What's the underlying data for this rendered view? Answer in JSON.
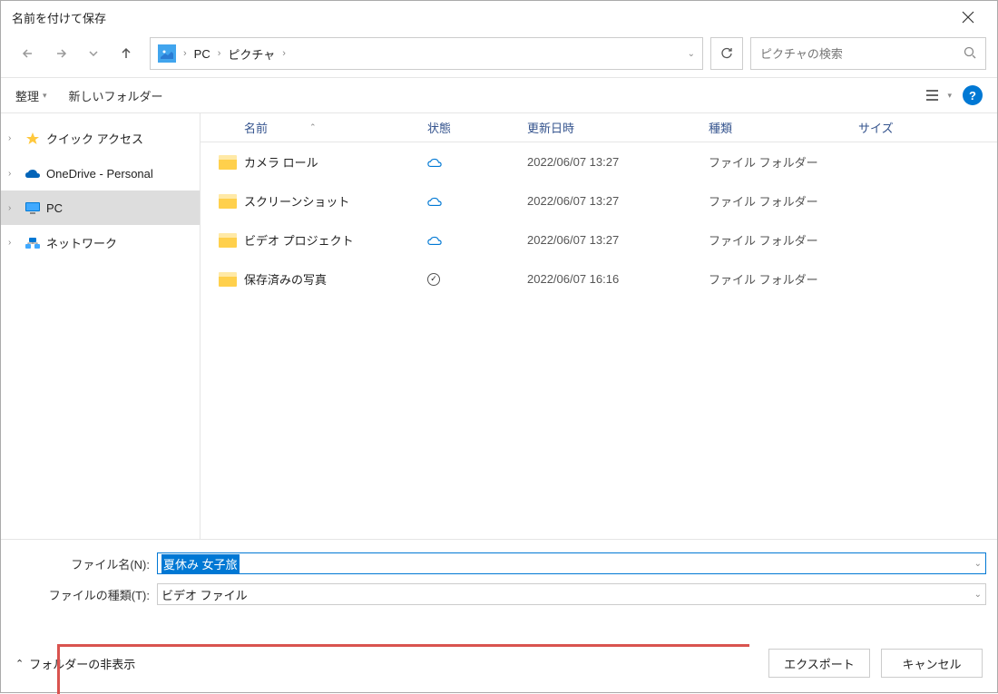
{
  "title": "名前を付けて保存",
  "breadcrumb": {
    "items": [
      "PC",
      "ピクチャ"
    ]
  },
  "search": {
    "placeholder": "ピクチャの検索"
  },
  "toolbar": {
    "organize": "整理",
    "newfolder": "新しいフォルダー"
  },
  "sidebar": {
    "items": [
      {
        "label": "クイック アクセス"
      },
      {
        "label": "OneDrive - Personal"
      },
      {
        "label": "PC"
      },
      {
        "label": "ネットワーク"
      }
    ]
  },
  "columns": {
    "name": "名前",
    "status": "状態",
    "date": "更新日時",
    "type": "種類",
    "size": "サイズ"
  },
  "files": [
    {
      "name": "カメラ ロール",
      "status": "cloud",
      "date": "2022/06/07 13:27",
      "type": "ファイル フォルダー"
    },
    {
      "name": "スクリーンショット",
      "status": "cloud",
      "date": "2022/06/07 13:27",
      "type": "ファイル フォルダー"
    },
    {
      "name": "ビデオ プロジェクト",
      "status": "cloud",
      "date": "2022/06/07 13:27",
      "type": "ファイル フォルダー"
    },
    {
      "name": "保存済みの写真",
      "status": "synced",
      "date": "2022/06/07 16:16",
      "type": "ファイル フォルダー"
    }
  ],
  "filename": {
    "label": "ファイル名(N):",
    "value": "夏休み 女子旅"
  },
  "filetype": {
    "label": "ファイルの種類(T):",
    "value": "ビデオ ファイル"
  },
  "actions": {
    "hidefolders": "フォルダーの非表示",
    "export": "エクスポート",
    "cancel": "キャンセル"
  },
  "help": "?"
}
